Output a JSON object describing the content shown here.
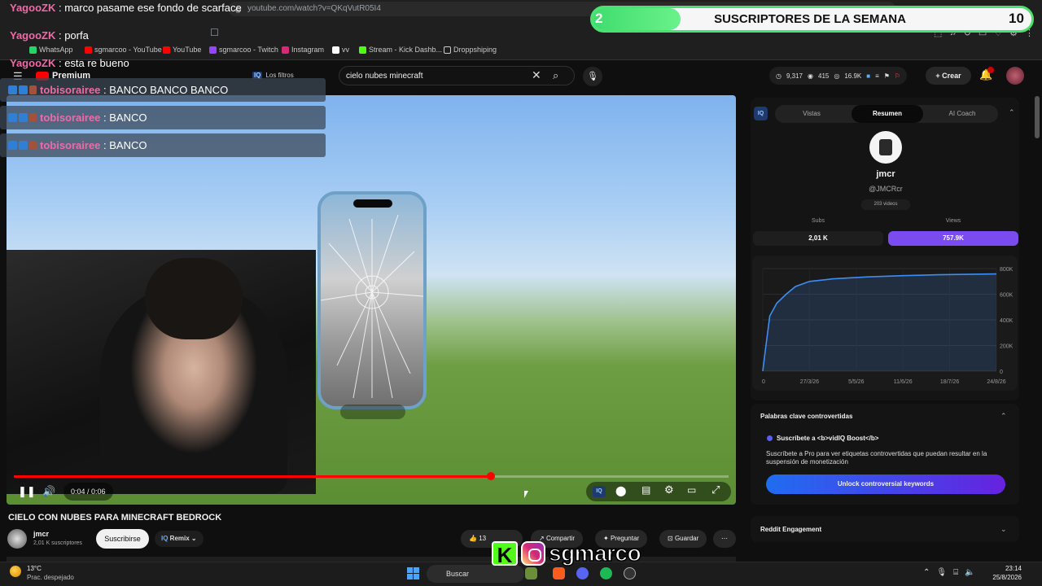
{
  "browser": {
    "url": "youtube.com/watch?v=QKqVutR05I4",
    "bookmarks": [
      "WhatsApp",
      "sgmarcoo - YouTube",
      "YouTube",
      "sgmarcoo - Twitch",
      "Instagram",
      "vv",
      "Stream - Kick Dashb...",
      "Droppshiping"
    ]
  },
  "youtube": {
    "logo_label": "Premium",
    "filters_label": "Los filtros",
    "search_query": "cielo nubes minecraft",
    "stats": {
      "views": "9,317",
      "watching": "415",
      "subs": "16.9K"
    },
    "create_label": "Crear",
    "notification_count": "1"
  },
  "video": {
    "time": "0:04 / 0:06",
    "progress": 0.667,
    "title": "CIELO CON NUBES PARA MINECRAFT BEDROCK"
  },
  "channel": {
    "name": "jmcr",
    "subscribers": "2,01 K suscriptores",
    "subscribe_label": "Suscribirse",
    "remix_label": "Remix"
  },
  "actions": {
    "likes": "13",
    "share_label": "Compartir",
    "ask_label": "Preguntar",
    "save_label": "Guardar"
  },
  "vidiq": {
    "tabs": [
      "Vistas",
      "Resumen",
      "AI Coach"
    ],
    "active_tab": "Resumen",
    "channel_name": "jmcr",
    "handle": "@JMCRcr",
    "videos": "203 videos",
    "subs_label": "Subs",
    "subs_value": "2,01 K",
    "views_label": "Views",
    "views_value": "757.9K",
    "keywords_title": "Palabras clave controvertidas",
    "keywords_subtitle": "Suscríbete a <b>vidIQ Boost</b>",
    "keywords_desc": "Suscríbete a Pro para ver etiquetas controvertidas que puedan resultar en la suspensión de monetización",
    "keywords_button": "Unlock controversial keywords",
    "reddit_title": "Reddit Engagement"
  },
  "chart_data": {
    "type": "line",
    "x": [
      "0",
      "27/3/26",
      "5/5/26",
      "11/6/26",
      "18/7/26",
      "24/8/26"
    ],
    "y_ticks": [
      "800K",
      "600K",
      "400K",
      "200K",
      "0"
    ],
    "ylim": [
      0,
      800000
    ],
    "series": [
      {
        "points": [
          [
            0,
            0
          ],
          [
            0.01,
            150000
          ],
          [
            0.03,
            430000
          ],
          [
            0.06,
            530000
          ],
          [
            0.1,
            600000
          ],
          [
            0.14,
            660000
          ],
          [
            0.2,
            700000
          ],
          [
            0.3,
            720000
          ],
          [
            0.45,
            735000
          ],
          [
            0.6,
            745000
          ],
          [
            0.75,
            752000
          ],
          [
            0.9,
            756000
          ],
          [
            1.0,
            757900
          ]
        ]
      }
    ],
    "grid": true
  },
  "chat": [
    {
      "user": "YagooZK",
      "message": "marco pasame ese fondo de scarface"
    },
    {
      "user": "YagooZK",
      "message": "porfa"
    },
    {
      "user": "YagooZK",
      "message": "esta re bueno"
    },
    {
      "user": "tobisorairee",
      "message": "BANCO BANCO BANCO"
    },
    {
      "user": "tobisorairee",
      "message": "BANCO"
    },
    {
      "user": "tobisorairee",
      "message": "BANCO"
    }
  ],
  "sub_goal": {
    "current": "2",
    "title": "SUSCRIPTORES DE LA SEMANA",
    "target": "10",
    "fraction": 0.2
  },
  "taskbar": {
    "temperature": "13°C",
    "weather": "Prac. despejado",
    "search_label": "Buscar",
    "time": "23:14",
    "date": "25/8/2026"
  },
  "watermark": {
    "handle": "sgmarco"
  }
}
